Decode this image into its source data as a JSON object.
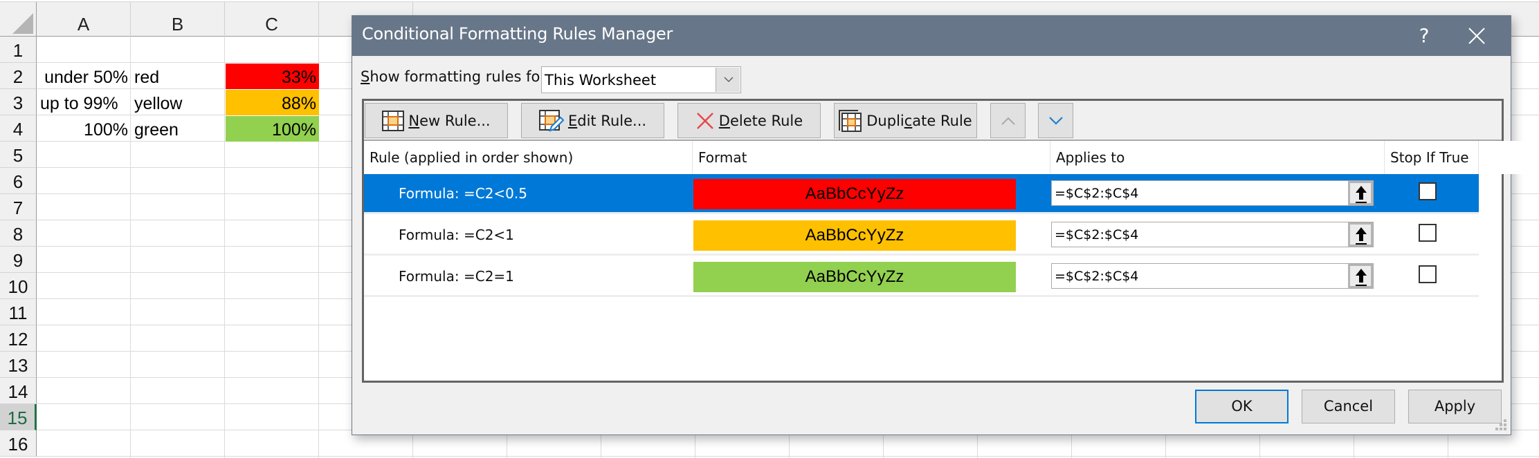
{
  "sheet": {
    "columns": [
      "A",
      "B",
      "C"
    ],
    "rows": [
      "1",
      "2",
      "3",
      "4",
      "5",
      "6",
      "7",
      "8",
      "9",
      "10",
      "11",
      "12",
      "13",
      "14",
      "15",
      "16"
    ],
    "selected_row": "15",
    "cells": {
      "A2": "under 50%",
      "B2": "red",
      "C2": "33%",
      "A3": "up to 99%",
      "B3": "yellow",
      "C3": "88%",
      "A4": "100%",
      "B4": "green",
      "C4": "100%"
    },
    "fill_colors": {
      "red": "#ff0000",
      "yellow": "#ffc000",
      "green": "#92d050"
    }
  },
  "dialog": {
    "title": "Conditional Formatting Rules Manager",
    "help_label": "?",
    "show_rules_label_prefix": "S",
    "show_rules_label_rest": "how formatting rules for:",
    "scope_select": {
      "value": "This Worksheet"
    },
    "toolbar": {
      "new_rule": {
        "accel": "N",
        "rest": "ew Rule..."
      },
      "edit_rule": {
        "accel": "E",
        "rest": "dit Rule..."
      },
      "delete_rule": {
        "accel": "D",
        "rest": "elete Rule"
      },
      "duplicate_rule": {
        "pre": "Dupli",
        "accel": "c",
        "rest": "ate Rule"
      }
    },
    "table": {
      "headers": [
        "Rule (applied in order shown)",
        "Format",
        "Applies to",
        "Stop If True"
      ],
      "rows": [
        {
          "rule": "Formula: =C2<0.5",
          "format_preview": "AaBbCcYyZz",
          "format_color": "#ff0000",
          "applies_to": "=$C$2:$C$4",
          "stop_if_true": false,
          "selected": true
        },
        {
          "rule": "Formula: =C2<1",
          "format_preview": "AaBbCcYyZz",
          "format_color": "#ffc000",
          "applies_to": "=$C$2:$C$4",
          "stop_if_true": false,
          "selected": false
        },
        {
          "rule": "Formula: =C2=1",
          "format_preview": "AaBbCcYyZz",
          "format_color": "#92d050",
          "applies_to": "=$C$2:$C$4",
          "stop_if_true": false,
          "selected": false
        }
      ]
    },
    "buttons": {
      "ok": "OK",
      "cancel": "Cancel",
      "apply": "Apply"
    },
    "colors": {
      "titlebar": "#687689",
      "selection": "#0078d7",
      "default_button_border": "#0078d7"
    }
  }
}
